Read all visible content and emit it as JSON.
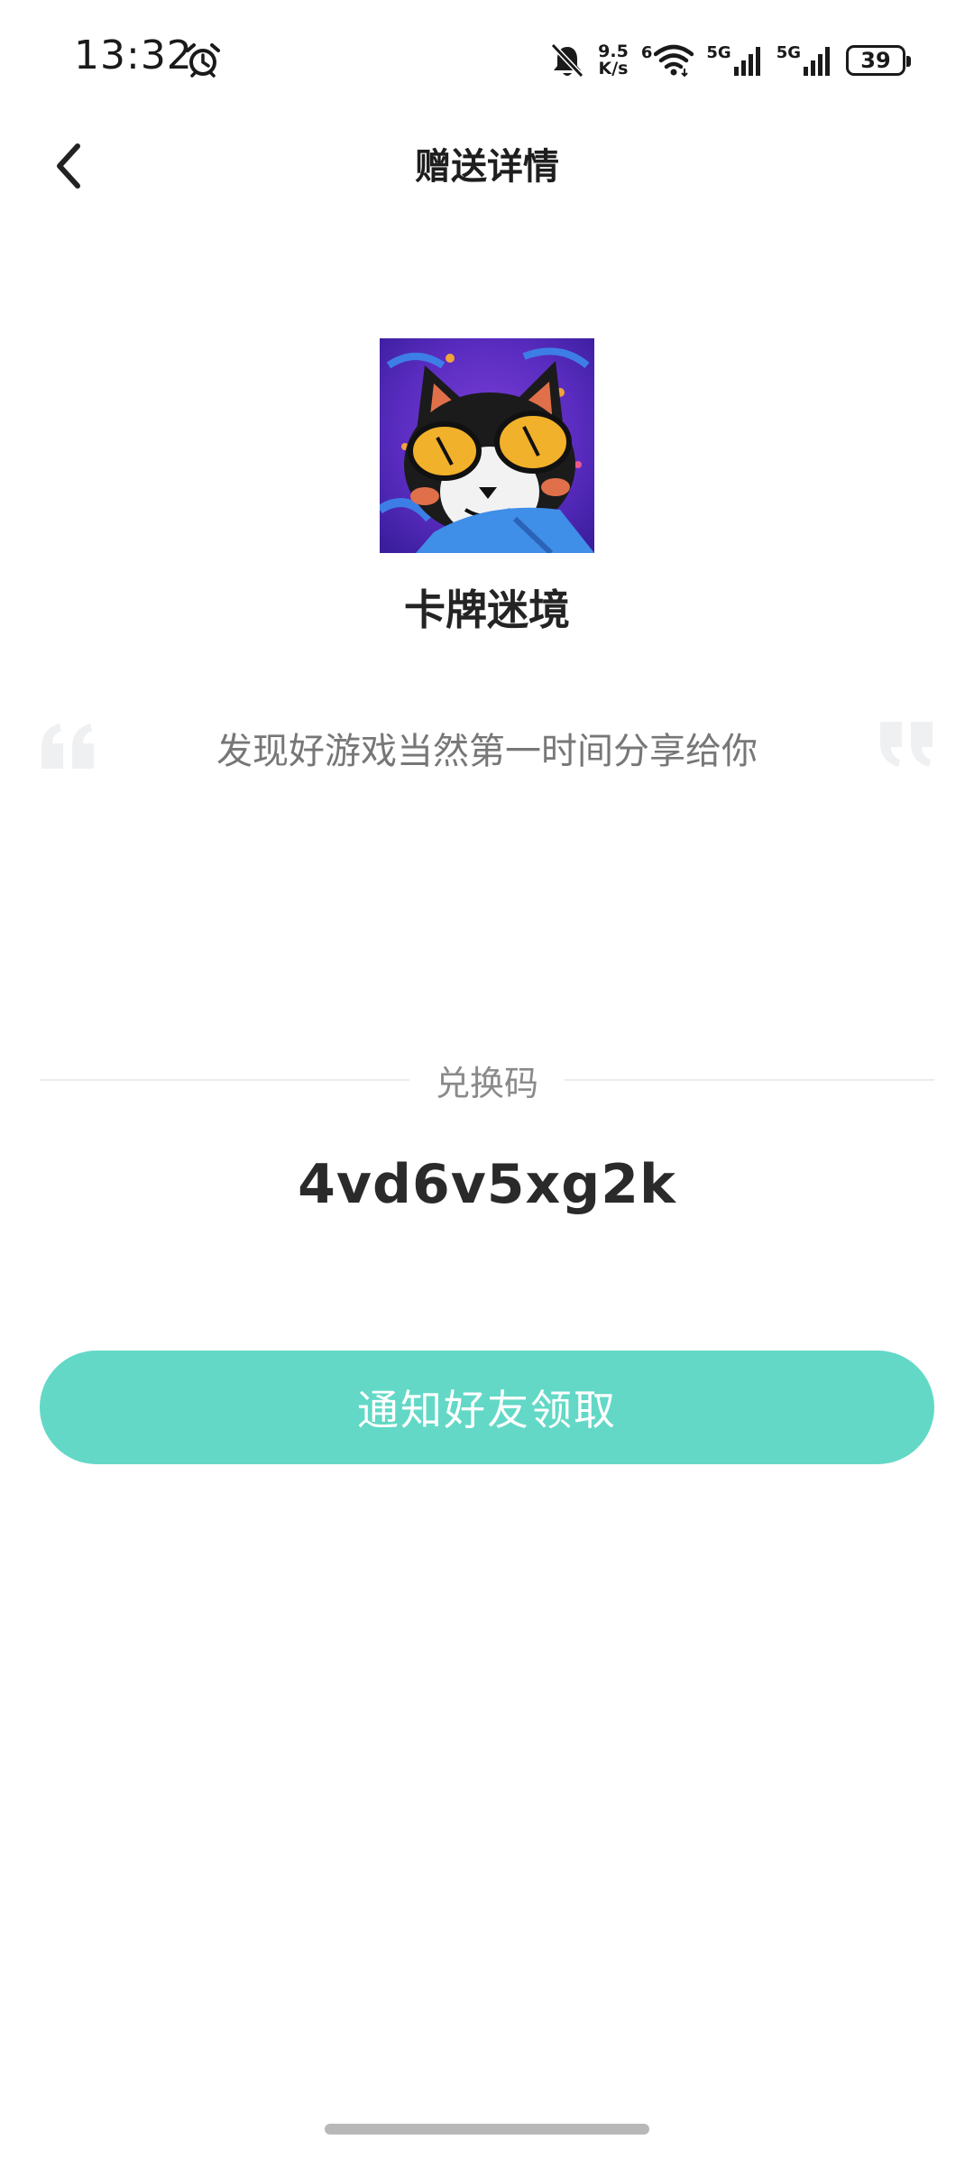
{
  "status_bar": {
    "time": "13:32",
    "net_speed_value": "9.5",
    "net_speed_unit": "K/s",
    "wifi_label": "6",
    "sim1_label": "5G",
    "sim2_label": "5G",
    "battery_level": "39",
    "icons": [
      "alarm-icon",
      "mute-bell-icon",
      "wifi-icon",
      "signal-icon",
      "battery-icon"
    ]
  },
  "nav": {
    "title": "赠送详情",
    "back_icon": "chevron-left-icon"
  },
  "game": {
    "name": "卡牌迷境"
  },
  "quote": {
    "text": "发现好游戏当然第一时间分享给你"
  },
  "redeem": {
    "label": "兑换码",
    "code": "4vd6v5xg2k"
  },
  "action": {
    "notify_label": "通知好友领取"
  },
  "colors": {
    "accent": "#63d8c6",
    "title_text": "#1e1e1e",
    "muted_text": "#8a8a8a",
    "quote_mark": "#eef0f2"
  }
}
